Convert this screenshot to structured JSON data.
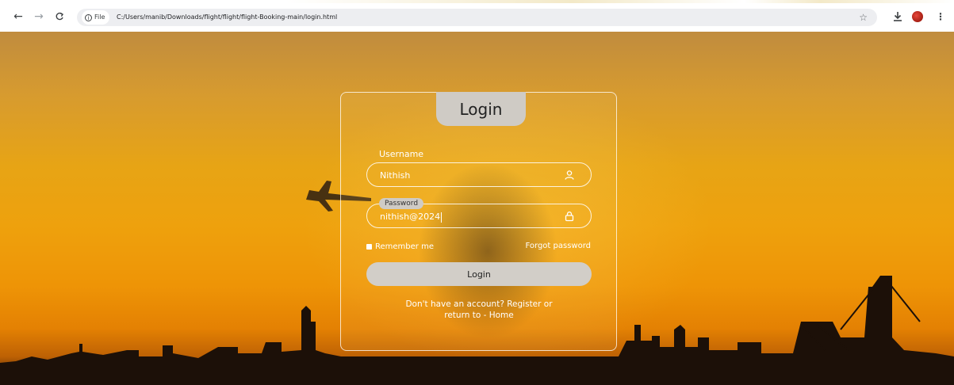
{
  "browser": {
    "back_icon": "arrow-left-icon",
    "forward_icon": "arrow-right-icon",
    "reload_icon": "reload-icon",
    "file_chip_label": "File",
    "url": "C:/Users/manib/Downloads/flight/flight/flight-Booking-main/login.html",
    "bookmark_icon": "star-icon",
    "download_icon": "download-icon",
    "menu_icon": "more-vertical-icon"
  },
  "login": {
    "title": "Login",
    "username_label": "Username",
    "username_value": "Nithish",
    "username_icon": "user-icon",
    "password_label": "Password",
    "password_value": "nithish@2024",
    "password_icon": "lock-icon",
    "remember_label": "Remember me",
    "forgot_label": "Forgot password",
    "submit_label": "Login",
    "register_line1": "Don't have an account? Register or",
    "register_line2": "return to - Home"
  },
  "colors": {
    "sky_top": "#c08c3e",
    "sky_mid": "#eea10d",
    "sky_bottom": "#2a1608",
    "title_tab": "#cfcbc5",
    "button": "#d2cec8"
  }
}
